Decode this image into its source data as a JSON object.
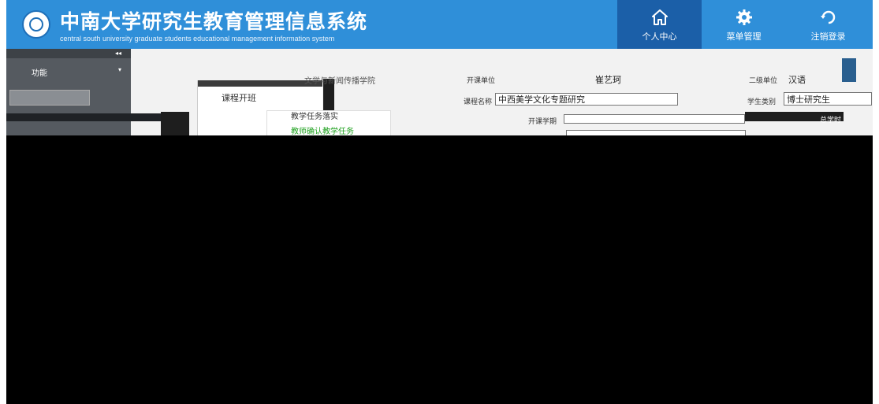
{
  "header": {
    "title": "中南大学研究生教育管理信息系统",
    "subtitle": "central south university graduate students educational management information system",
    "nav": [
      {
        "label": "个人中心",
        "icon": "home-icon"
      },
      {
        "label": "菜单管理",
        "icon": "gear-icon"
      },
      {
        "label": "注销登录",
        "icon": "logout-icon"
      }
    ]
  },
  "sidebar": {
    "collapse_glyph": "◂◂",
    "function_label": "功能",
    "function_chevron": "▾"
  },
  "menu": {
    "items": [
      {
        "label": "课程开班"
      }
    ]
  },
  "submenu": {
    "items": [
      {
        "label": "教学任务落实"
      },
      {
        "label": "教师确认教学任务"
      }
    ]
  },
  "form": {
    "row1": {
      "dept_label": "开课单位",
      "dept_value": "文学与新闻传播学院",
      "teacher_value": "崔艺珂",
      "dept2_label": "二级单位",
      "dept2_value": "汉语"
    },
    "row2": {
      "course_label": "课程名称",
      "course_value": "中西美学文化专题研究",
      "type_label": "学生类别",
      "type_value": "博士研究生"
    },
    "row3": {
      "semester_label": "开课学期",
      "hours_label": "总学时"
    }
  },
  "colors": {
    "header_bg": "#2f8fd9",
    "header_active": "#1b5fa8",
    "sidebar_bg": "#555a60",
    "green_text": "#1ea01e"
  }
}
